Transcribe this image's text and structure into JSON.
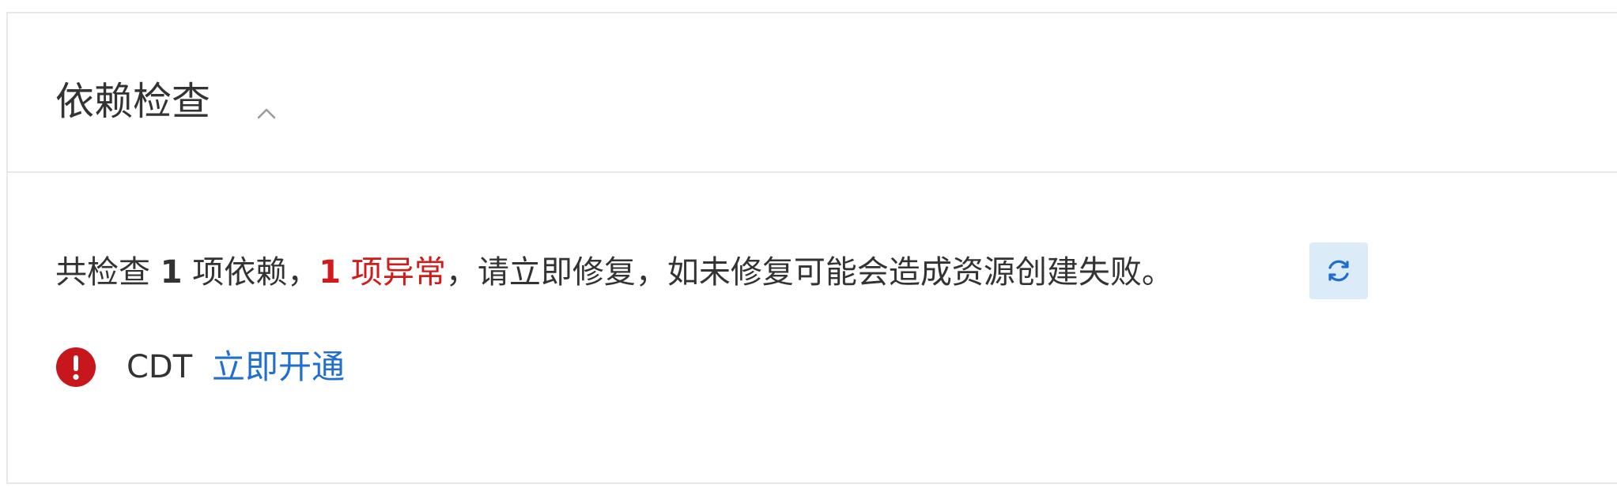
{
  "section": {
    "title": "依赖检查",
    "collapse_icon": "chevron-up-icon"
  },
  "summary": {
    "prefix": "共检查 ",
    "checked_count": "1",
    "mid": " 项依赖，",
    "abnormal_count": "1",
    "abnormal_text": " 项异常",
    "suffix": "，请立即修复，如未修复可能会造成资源创建失败。",
    "refresh_icon": "refresh-icon"
  },
  "dependencies": [
    {
      "status_icon": "error-icon",
      "name": "CDT",
      "action_label": "立即开通"
    }
  ],
  "colors": {
    "error": "#d11a1a",
    "link": "#1f6fd1",
    "refresh_bg": "#dcebf8",
    "border": "#e8e8e8"
  }
}
